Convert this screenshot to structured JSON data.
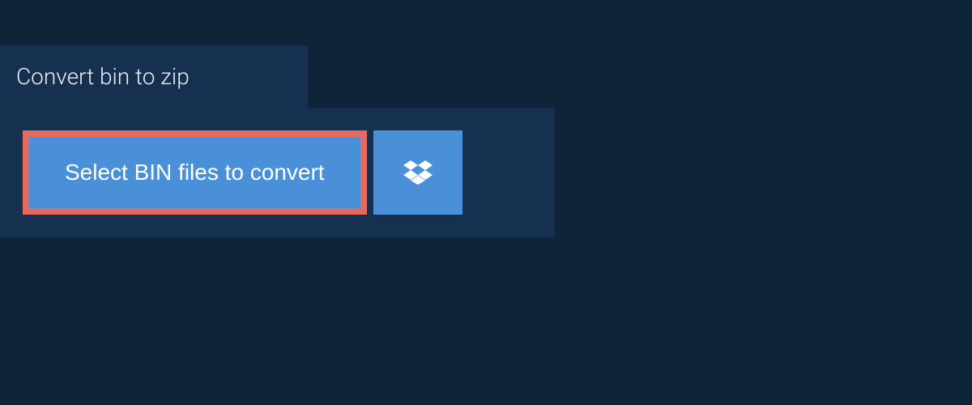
{
  "header": {
    "title": "Convert bin to zip"
  },
  "upload": {
    "select_button_label": "Select BIN files to convert",
    "dropbox_icon": "dropbox-icon"
  },
  "colors": {
    "background": "#0f2438",
    "panel": "#163150",
    "accent": "#4a90d9",
    "highlight_border": "#e26a5f",
    "text_light": "#e8eef4"
  }
}
